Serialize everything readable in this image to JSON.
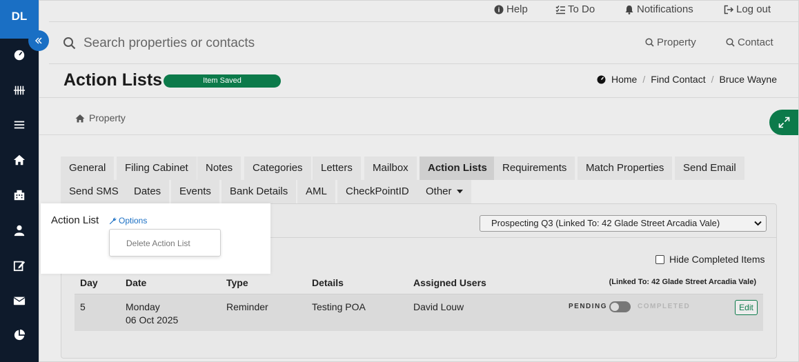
{
  "app": {
    "logo_text": "DL"
  },
  "topbar": {
    "help": "Help",
    "todo": "To Do",
    "notifications": "Notifications",
    "logout": "Log out"
  },
  "search": {
    "placeholder": "Search properties or contacts",
    "property_btn": "Property",
    "contact_btn": "Contact"
  },
  "header": {
    "title": "Action Lists",
    "badge": "Item Saved",
    "breadcrumb": [
      "Home",
      "Find Contact",
      "Bruce Wayne"
    ]
  },
  "subnav": {
    "property_link": "Property"
  },
  "tabs": {
    "row1": [
      "General",
      "Filing Cabinet",
      "Notes",
      "Categories",
      "Letters",
      "Mailbox",
      "Action Lists",
      "Requirements",
      "Match Properties",
      "Send Email"
    ],
    "row2": [
      "Send SMS",
      "Dates",
      "Events",
      "Bank Details",
      "AML",
      "CheckPointID",
      "Other"
    ],
    "active": "Action Lists"
  },
  "action_list": {
    "title": "Action List",
    "options_label": "Options",
    "dropdown_item": "Delete Action List",
    "selected_list": "Prospecting Q3 (Linked To: 42 Glade Street Arcadia Vale)",
    "hide_completed_label": "Hide Completed Items",
    "hide_completed_checked": false
  },
  "table": {
    "headers": [
      "Day",
      "Date",
      "Type",
      "Details",
      "Assigned Users"
    ],
    "linked_header": "(Linked To: 42 Glade Street Arcadia Vale)",
    "rows": [
      {
        "day": "5",
        "date_line1": "Monday",
        "date_line2": "06 Oct 2025",
        "type": "Reminder",
        "details": "Testing POA",
        "assigned": "David Louw",
        "status_pending": "PENDING",
        "status_completed": "COMPLETED",
        "completed": false,
        "edit": "Edit"
      }
    ]
  },
  "colors": {
    "sidebar": "#0e1a2b",
    "accent_blue": "#1a6fc4",
    "accent_green": "#0c7a4a"
  }
}
